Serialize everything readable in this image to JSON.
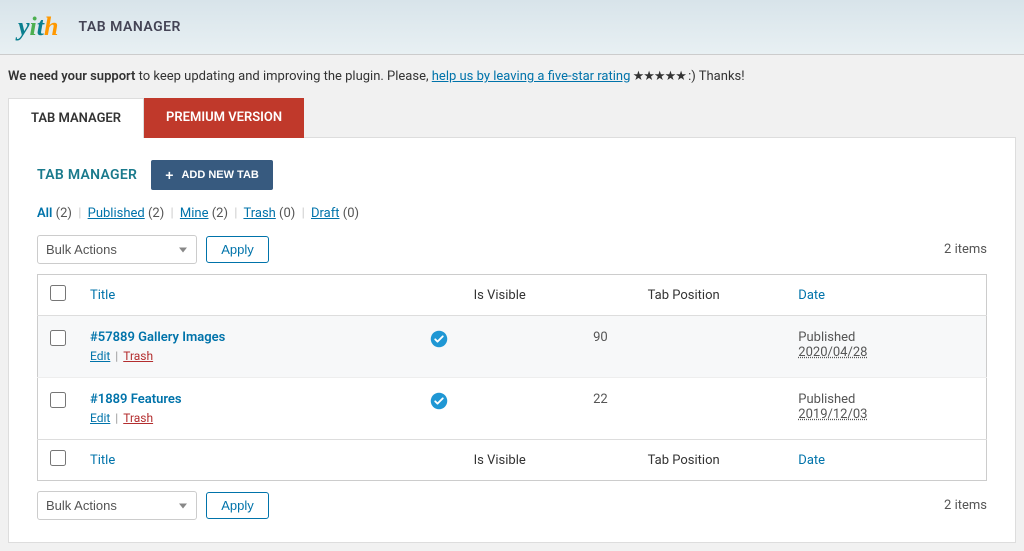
{
  "header": {
    "logo_text": "yith",
    "page_title": "TAB MANAGER"
  },
  "support_notice": {
    "bold": "We need your support",
    "text1": " to keep updating and improving the plugin. Please, ",
    "link": "help us by leaving a five-star rating",
    "stars": " ★★★★★ ",
    "text2": ":) Thanks!"
  },
  "tabs": {
    "main": "TAB MANAGER",
    "premium": "PREMIUM VERSION"
  },
  "panel": {
    "heading": "TAB MANAGER",
    "add_button": "ADD NEW TAB"
  },
  "filters": {
    "all_label": "All",
    "all_count": "(2)",
    "published_label": "Published",
    "published_count": "(2)",
    "mine_label": "Mine",
    "mine_count": "(2)",
    "trash_label": "Trash",
    "trash_count": "(0)",
    "draft_label": "Draft",
    "draft_count": "(0)"
  },
  "bulk": {
    "placeholder": "Bulk Actions",
    "apply": "Apply"
  },
  "pagination": {
    "items": "2 items"
  },
  "columns": {
    "title": "Title",
    "visible": "Is Visible",
    "position": "Tab Position",
    "date": "Date"
  },
  "row_actions": {
    "edit": "Edit",
    "trash": "Trash"
  },
  "rows": [
    {
      "title": "#57889 Gallery Images",
      "position": "90",
      "status": "Published",
      "date": "2020/04/28"
    },
    {
      "title": "#1889 Features",
      "position": "22",
      "status": "Published",
      "date": "2019/12/03"
    }
  ]
}
